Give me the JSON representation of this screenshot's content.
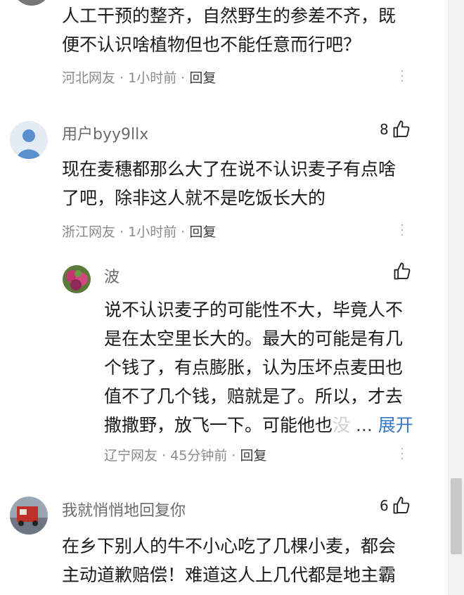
{
  "comments": [
    {
      "content_lines": [
        "人工干预的整齐，自然野生的参差不齐，既",
        "便不认识啥植物但也不能任意而行吧？"
      ],
      "location": "河北网友",
      "time": "1小时前",
      "reply_label": "回复"
    },
    {
      "user": "用户byy9llx",
      "likes": "8",
      "content_lines": [
        "现在麦穗都那么大了在说不认识麦子有点啥",
        "了吧，除非这人就不是吃饭长大的"
      ],
      "location": "浙江网友",
      "time": "1小时前",
      "reply_label": "回复"
    },
    {
      "user": "波",
      "content_lines": [
        "说不认识麦子的可能性不大，毕竟人不",
        "是在太空里长大的。最大的可能是有几",
        "个钱了，有点膨胀，认为压坏点麦田也",
        "值不了几个钱，赔就是了。所以，才去"
      ],
      "last_line_text": "撒撒野，放飞一下。可能他也",
      "last_line_fade": "没",
      "ellipsis": "...",
      "expand_label": "展开",
      "location": "辽宁网友",
      "time": "45分钟前",
      "reply_label": "回复"
    },
    {
      "user": "我就悄悄地回复你",
      "likes": "6",
      "content_lines": [
        "在乡下别人的牛不小心吃了几棵小麦，都会",
        "主动道歉赔偿！难道这人上几代都是地主霸"
      ]
    }
  ],
  "separator": "·",
  "icons": [
    "thumbs-up-icon",
    "more-vertical-icon",
    "default-avatar-icon"
  ],
  "colors": {
    "link": "#3478c6",
    "meta": "#8a8a8a",
    "username": "#6b6b6b"
  }
}
